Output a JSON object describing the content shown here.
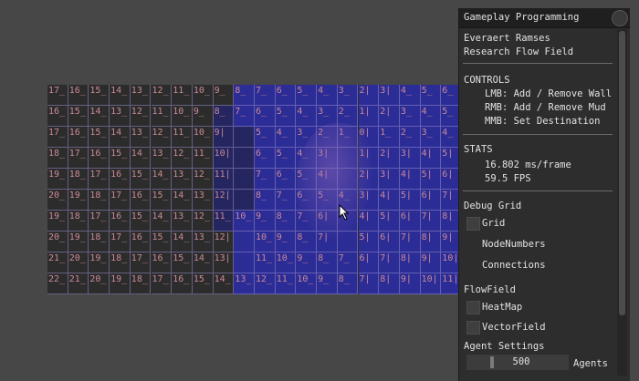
{
  "panel": {
    "title": "Gameplay Programming",
    "author": "Everaert Ramses",
    "project": "Research Flow Field",
    "controls_heading": "CONTROLS",
    "controls": [
      "LMB: Add / Remove Wall",
      "RMB: Add / Remove Mud",
      "MMB: Set Destination"
    ],
    "stats_heading": "STATS",
    "frame_time": "16.802 ms/frame",
    "fps": "59.5 FPS",
    "debug_grid_heading": "Debug Grid",
    "debug_options": [
      "Grid",
      "NodeNumbers",
      "Connections"
    ],
    "flowfield_heading": "FlowField",
    "flowfield_options": [
      "HeatMap",
      "VectorField"
    ],
    "agent_heading": "Agent Settings",
    "agents_value": "500",
    "agents_label": "Agents"
  },
  "grid": {
    "columns": 20,
    "rows": 10,
    "layout_type": "flow-field heat numbers",
    "water_from_col": 9,
    "wall_cells": [
      [
        1,
        8
      ],
      [
        2,
        8
      ],
      [
        3,
        8
      ],
      [
        4,
        8
      ],
      [
        5,
        8
      ],
      [
        6,
        8
      ],
      [
        2,
        9
      ],
      [
        3,
        9
      ],
      [
        4,
        9
      ],
      [
        5,
        9
      ]
    ],
    "rows_data": [
      [
        "17_",
        "16_",
        "15_",
        "14_",
        "13_",
        "12_",
        "11_",
        "10_",
        "9_",
        "8_",
        "7_",
        "6_",
        "5_",
        "4_",
        "3_",
        "2|",
        "3|",
        "4_",
        "5_",
        "6_"
      ],
      [
        "16_",
        "15_",
        "14_",
        "13_",
        "12_",
        "11_",
        "10_",
        "9_",
        "8_",
        "7_",
        "6_",
        "5_",
        "4_",
        "3_",
        "2_",
        "1|",
        "2|",
        "3_",
        "4_",
        "5_"
      ],
      [
        "17_",
        "16_",
        "15_",
        "14_",
        "13_",
        "12_",
        "11_",
        "10_",
        "9|",
        "",
        "5_",
        "4_",
        "3_",
        "2_",
        "1_",
        "0|",
        "1_",
        "2_",
        "3_",
        "4_"
      ],
      [
        "18_",
        "17_",
        "16_",
        "15_",
        "14_",
        "13_",
        "12_",
        "11_",
        "10|",
        "",
        "6_",
        "5_",
        "4_",
        "3|",
        "",
        "1|",
        "2|",
        "3|",
        "4|",
        "5|"
      ],
      [
        "19_",
        "18_",
        "17_",
        "16_",
        "15_",
        "14_",
        "13_",
        "12_",
        "11|",
        "",
        "7_",
        "6_",
        "5_",
        "4|",
        "",
        "2|",
        "3|",
        "4|",
        "5|",
        "6|"
      ],
      [
        "20_",
        "19_",
        "18_",
        "17_",
        "16_",
        "15_",
        "14_",
        "13_",
        "12|",
        "",
        "8_",
        "7_",
        "6_",
        "5_",
        "4_",
        "3|",
        "4|",
        "5|",
        "6|",
        "7|"
      ],
      [
        "19_",
        "18_",
        "17_",
        "16_",
        "15_",
        "14_",
        "13_",
        "12_",
        "11_",
        "10_",
        "9_",
        "8_",
        "7_",
        "6|",
        "",
        "4|",
        "5|",
        "6|",
        "7|",
        "8|"
      ],
      [
        "20_",
        "19_",
        "18_",
        "17_",
        "16_",
        "15_",
        "14_",
        "13_",
        "12|",
        "",
        "10_",
        "9_",
        "8_",
        "7|",
        "",
        "5|",
        "6|",
        "7|",
        "8|",
        "9|"
      ],
      [
        "21_",
        "20_",
        "19_",
        "18_",
        "17_",
        "16_",
        "15_",
        "14_",
        "13|",
        "",
        "11_",
        "10_",
        "9_",
        "8_",
        "7_",
        "6|",
        "7|",
        "8|",
        "9|",
        "10|"
      ],
      [
        "22_",
        "21_",
        "20_",
        "19_",
        "18_",
        "17_",
        "16_",
        "15_",
        "14_",
        "13_",
        "12_",
        "11_",
        "10_",
        "9_",
        "8_",
        "7|",
        "8|",
        "9|",
        "10|",
        "11|"
      ]
    ]
  }
}
